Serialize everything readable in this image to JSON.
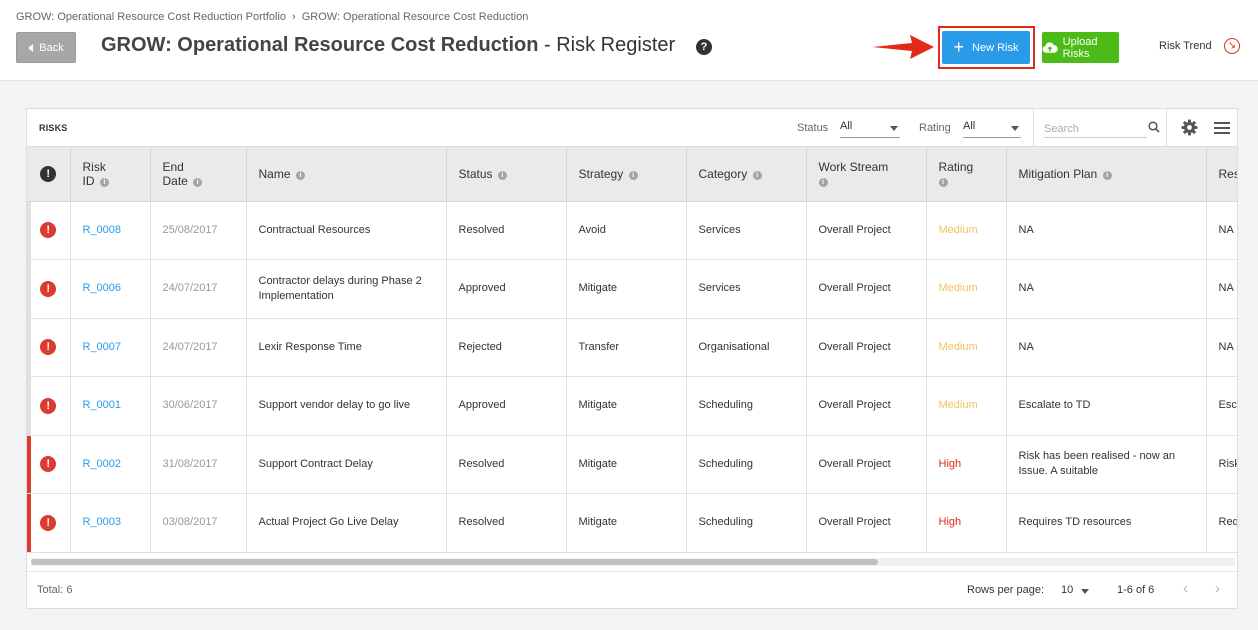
{
  "breadcrumb": [
    "GROW: Operational Resource Cost Reduction Portfolio",
    "GROW: Operational Resource Cost Reduction"
  ],
  "back_label": "Back",
  "title_bold": "GROW: Operational Resource Cost Reduction",
  "title_rest": " - Risk Register",
  "help_glyph": "?",
  "new_risk_label": "New Risk",
  "upload_risks_label": "Upload Risks",
  "risk_trend_label": "Risk Trend",
  "panel": {
    "title": "RISKS",
    "status_label": "Status",
    "status_value": "All",
    "rating_label": "Rating",
    "rating_value": "All",
    "search_placeholder": "Search"
  },
  "columns": {
    "risk_id_1": "Risk",
    "risk_id_2": "ID",
    "end_date_1": "End",
    "end_date_2": "Date",
    "name": "Name",
    "status": "Status",
    "strategy": "Strategy",
    "category": "Category",
    "work_stream": "Work Stream",
    "rating": "Rating",
    "mitigation_plan": "Mitigation Plan",
    "next": "Res"
  },
  "rows": [
    {
      "id": "R_0008",
      "end_date": "25/08/2017",
      "name": "Contractual Resources",
      "status": "Resolved",
      "strategy": "Avoid",
      "category": "Services",
      "work_stream": "Overall Project",
      "rating": "Medium",
      "mitigation": "NA",
      "next": "NA"
    },
    {
      "id": "R_0006",
      "end_date": "24/07/2017",
      "name": "Contractor delays during Phase 2 Implementation",
      "status": "Approved",
      "strategy": "Mitigate",
      "category": "Services",
      "work_stream": "Overall Project",
      "rating": "Medium",
      "mitigation": "NA",
      "next": "NA"
    },
    {
      "id": "R_0007",
      "end_date": "24/07/2017",
      "name": "Lexir Response Time",
      "status": "Rejected",
      "strategy": "Transfer",
      "category": "Organisational",
      "work_stream": "Overall Project",
      "rating": "Medium",
      "mitigation": "NA",
      "next": "NA"
    },
    {
      "id": "R_0001",
      "end_date": "30/06/2017",
      "name": "Support vendor delay to go live",
      "status": "Approved",
      "strategy": "Mitigate",
      "category": "Scheduling",
      "work_stream": "Overall Project",
      "rating": "Medium",
      "mitigation": "Escalate to TD",
      "next": "Esca"
    },
    {
      "id": "R_0002",
      "end_date": "31/08/2017",
      "name": "Support Contract Delay",
      "status": "Resolved",
      "strategy": "Mitigate",
      "category": "Scheduling",
      "work_stream": "Overall Project",
      "rating": "High",
      "mitigation": "Risk has been realised - now an Issue. A suitable",
      "next": "Risk Issu"
    },
    {
      "id": "R_0003",
      "end_date": "03/08/2017",
      "name": "Actual Project Go Live Delay",
      "status": "Resolved",
      "strategy": "Mitigate",
      "category": "Scheduling",
      "work_stream": "Overall Project",
      "rating": "High",
      "mitigation": "Requires TD resources",
      "next": "Req"
    }
  ],
  "footer": {
    "total": "Total: 6",
    "rows_per_page_label": "Rows per page:",
    "rows_per_page_value": "10",
    "range": "1-6 of 6"
  },
  "colors": {
    "primary_blue": "#2a9be6",
    "upload_green": "#4cbb17",
    "alert_red": "#dd3b2f",
    "rating_medium": "#f5c35a",
    "rating_high": "#e3291a",
    "annotation_red": "#e3291a"
  }
}
